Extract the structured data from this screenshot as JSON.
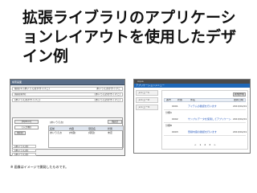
{
  "slide": {
    "title": "拡張ライブラリのアプリケーションレイアウトを使用したデザイン例",
    "footnote": "※ 画像はイメージで開発したものです。"
  },
  "screenshot_a": {
    "window_title": "検索画面",
    "rows": [
      {
        "label": "検索(1)  [あいうえおかきくけこ]",
        "right": "あいうえおかきくけこ"
      },
      {
        "label": "[検索条件]",
        "right": "[あいうえおかきくけこ]"
      },
      {
        "label": "[あいうえおかきくけこ]",
        "right": "[あいうえおかきくけこ]"
      }
    ],
    "side_buttons": [
      "[Option]",
      "[入力欄]",
      "[検索]"
    ],
    "panel_tab": "[あいうえお]",
    "panel_action": "[設定]",
    "grid": {
      "headers": [
        "名前",
        "内容",
        "項目名",
        "状態"
      ],
      "row": [
        "あいうえお",
        "[内容]",
        "[項目]",
        "未定"
      ]
    },
    "bottom_rows": [
      "[あいうえお]",
      "[あいうえお]",
      "[あいうえお]"
    ]
  },
  "screenshot_b": {
    "app_name": "Aqua",
    "header_title": "アプリケーションメニュー",
    "nav_items": [
      "メニュー1",
      "メニュー2",
      "メニュー3"
    ],
    "button_label": "新規作成",
    "table_headers": [
      "番号",
      "状態",
      "件名",
      "更新日時"
    ],
    "rows": [
      {
        "id": "0001",
        "text": "アイテムの確認を行います",
        "date": "2013/01/01"
      },
      {
        "id": "0002",
        "text": "サンプルデータを使用してアプリケーションを作成しています。",
        "date": "2013/01/01"
      },
      {
        "id": "0003",
        "text": "登録内容の確認を行います",
        "date": "2013/01/01"
      }
    ],
    "sub_labels": [
      "分類A",
      "分類B"
    ],
    "pager": [
      "<",
      "1",
      "2",
      "3",
      ">"
    ]
  },
  "colors": {
    "window_titlebar": "#5b6f8a",
    "header_blue": "#1d67b8",
    "topbar_dark": "#4a4a4a",
    "link": "#2255bb"
  }
}
